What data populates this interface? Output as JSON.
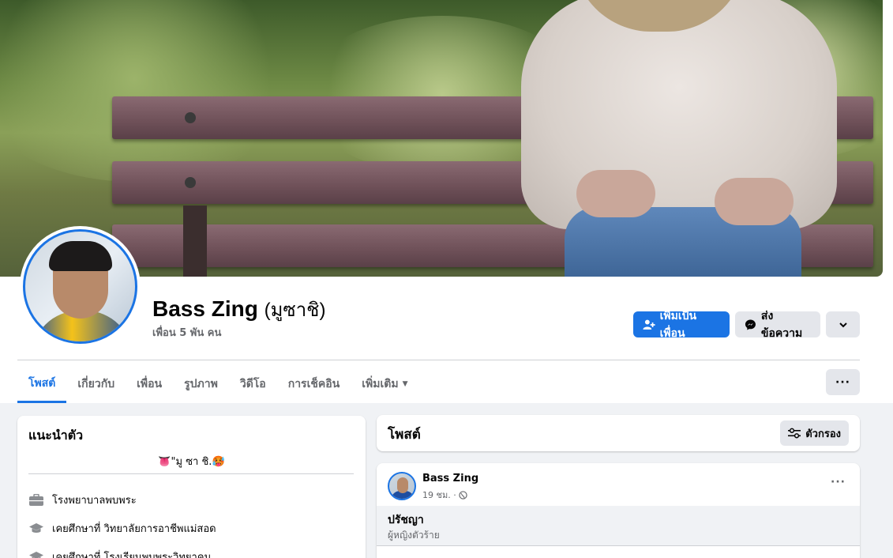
{
  "profile": {
    "name": "Bass Zing",
    "alt_name": "(มูซาชิ)",
    "friends": "เพื่อน 5 พัน คน"
  },
  "actions": {
    "add_friend": "เพิ่มเป็นเพื่อน",
    "message": "ส่งข้อความ",
    "more_icon": "chevron-down-icon"
  },
  "tabs": [
    {
      "label": "โพสต์",
      "active": true
    },
    {
      "label": "เกี่ยวกับ"
    },
    {
      "label": "เพื่อน"
    },
    {
      "label": "รูปภาพ"
    },
    {
      "label": "วิดีโอ"
    },
    {
      "label": "การเช็คอิน"
    },
    {
      "label": "เพิ่มเติม"
    }
  ],
  "tab_menu": "···",
  "intro": {
    "title": "แนะนำตัว",
    "bio": "👅\"มู ซา ชิ.🥵",
    "items": [
      {
        "icon": "briefcase-icon",
        "text": "โรงพยาบาลพบพระ"
      },
      {
        "icon": "graduation-cap-icon",
        "text": "เคยศึกษาที่ วิทยาลัยการอาชีพแม่สอด"
      },
      {
        "icon": "graduation-cap-icon",
        "text": "เคยศึกษาที่ โรงเรียนพบพระวิทยาคม"
      }
    ]
  },
  "posts_header": {
    "title": "โพสต์",
    "filter": "ตัวกรอง"
  },
  "post": {
    "author": "Bass Zing",
    "time": "19 ชม. ·",
    "privacy_icon": "globe-icon",
    "title": "ปรัชญา",
    "subtitle": "ผู้หญิงตัวร้าย",
    "menu": "···"
  },
  "colors": {
    "accent": "#1b74e4",
    "button_gray": "#e4e6eb",
    "page_bg": "#f0f2f5",
    "muted_text": "#65676b"
  }
}
